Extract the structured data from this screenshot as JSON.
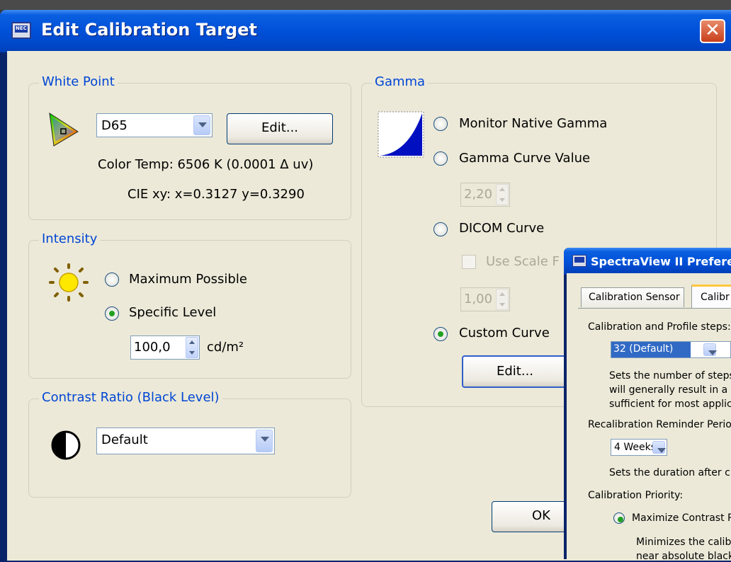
{
  "window": {
    "title": "Edit Calibration Target",
    "close": "✕",
    "icon_text": "NEC"
  },
  "white_point": {
    "label": "White Point",
    "preset": "D65",
    "edit_button": "Edit...",
    "color_temp": "Color Temp:  6506 K (0.0001 Δ uv)",
    "cie": "CIE xy:  x=0.3127 y=0.3290"
  },
  "intensity": {
    "label": "Intensity",
    "maximum": "Maximum Possible",
    "specific": "Specific Level",
    "value": "100,0",
    "unit": "cd/m²",
    "selected": "specific"
  },
  "contrast": {
    "label": "Contrast Ratio (Black Level)",
    "value": "Default"
  },
  "gamma": {
    "label": "Gamma",
    "native": "Monitor Native Gamma",
    "curve_value": "Gamma Curve Value",
    "curve_input": "2,20",
    "dicom": "DICOM Curve",
    "use_scale": "Use Scale F",
    "scale_input": "1,00",
    "custom": "Custom Curve",
    "edit_button": "Edit...",
    "selected": "custom"
  },
  "ok_button": "OK",
  "prefs": {
    "title": "SpectraView II Prefere",
    "tab1": "Calibration Sensor",
    "tab2": "Calibr",
    "steps_label": "Calibration and Profile steps:",
    "steps_value": "32 (Default)",
    "desc1": "Sets the number of steps",
    "desc2": "will generally result in a m",
    "desc3": "sufficient for most applica",
    "recal_label": "Recalibration Reminder Perio",
    "recal_value": "4 Weeks",
    "recal_desc": "Sets the duration after c",
    "priority_label": "Calibration Priority:",
    "priority_opt": "Maximize Contrast R",
    "prio_desc1": "Minimizes the calibra",
    "prio_desc2": "near absolute black"
  },
  "colors": {
    "accent": "#0046d5",
    "title": "#0050d8",
    "bg": "#ece9d8"
  }
}
